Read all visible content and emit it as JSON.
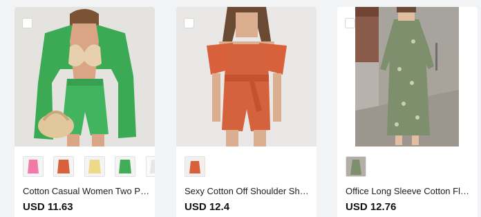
{
  "products": [
    {
      "title": "Cotton Casual Women Two Piece Set",
      "price": "USD 11.63",
      "thumbnails": [
        "pink",
        "orange",
        "yellow",
        "green",
        "white"
      ]
    },
    {
      "title": "Sexy Cotton Off Shoulder Short Jumpsuit",
      "price": "USD 12.4",
      "thumbnails": [
        "orange"
      ]
    },
    {
      "title": "Office Long Sleeve Cotton Floral Dress",
      "price": "USD 12.76",
      "thumbnails": [
        "green-floral"
      ]
    }
  ],
  "colors": {
    "pink": "#f07aa8",
    "orange": "#d8603a",
    "yellow": "#ecd98a",
    "green": "#3fae57",
    "white": "#f3f3f0",
    "green-floral": "#7d8f6c"
  }
}
